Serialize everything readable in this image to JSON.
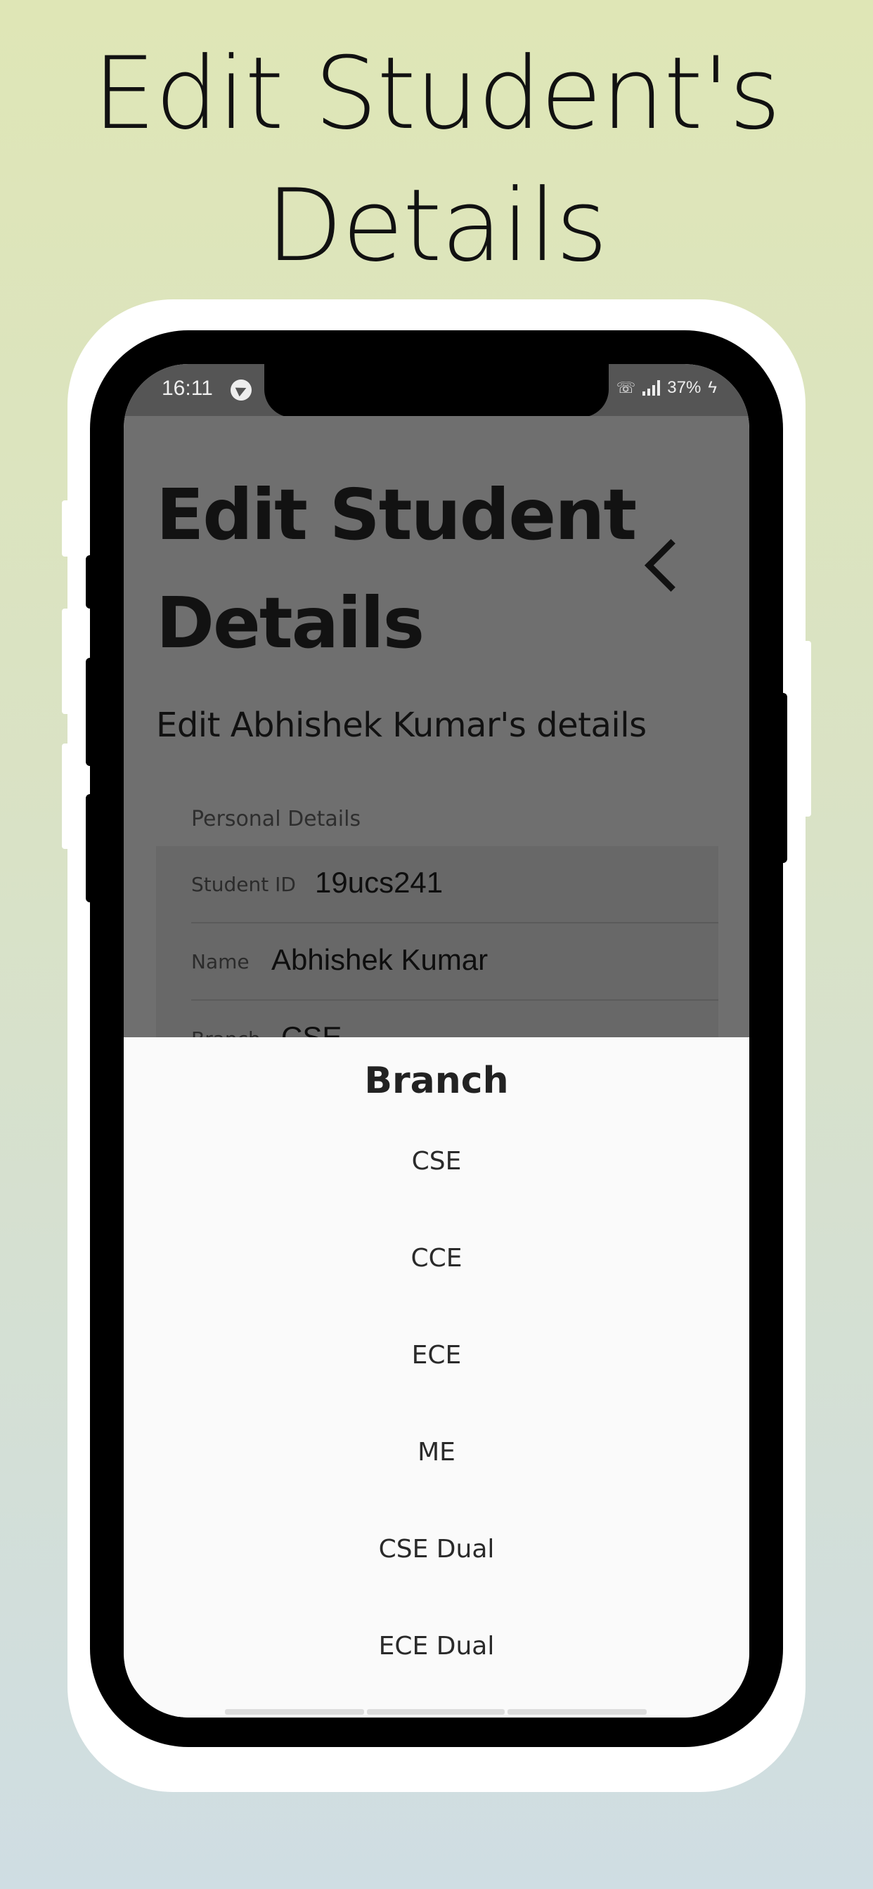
{
  "promo": {
    "title_line1": "Edit Student's",
    "title_line2": "Details"
  },
  "status_bar": {
    "time": "16:11",
    "battery": "37%"
  },
  "app": {
    "title_line1": "Edit Student",
    "title_line2": "Details",
    "subtitle": "Edit Abhishek Kumar's details",
    "section_label": "Personal Details",
    "fields": [
      {
        "label": "Student ID",
        "value": "19ucs241"
      },
      {
        "label": "Name",
        "value": "Abhishek Kumar"
      },
      {
        "label": "Branch",
        "value": "CSE"
      }
    ]
  },
  "sheet": {
    "title": "Branch",
    "options": [
      "CSE",
      "CCE",
      "ECE",
      "ME",
      "CSE Dual",
      "ECE Dual"
    ]
  },
  "colors": {
    "overlay": "#6f6f6f",
    "sheet_bg": "#fafafa",
    "frame": "#000000"
  },
  "icons": {
    "back": "chevron-left-icon",
    "telegram": "telegram-icon",
    "signal": "signal-icon",
    "call": "wifi-call-icon",
    "charging": "charging-icon"
  }
}
